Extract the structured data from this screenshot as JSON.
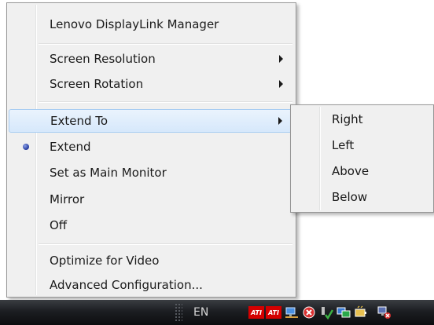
{
  "menu": {
    "items": [
      {
        "label": "Lenovo DisplayLink Manager"
      },
      {
        "label": "Screen Resolution",
        "submenu": true
      },
      {
        "label": "Screen Rotation",
        "submenu": true
      },
      {
        "label": "Extend To",
        "submenu": true,
        "highlighted": true
      },
      {
        "label": "Extend",
        "checked": true
      },
      {
        "label": "Set as Main Monitor"
      },
      {
        "label": "Mirror"
      },
      {
        "label": "Off"
      },
      {
        "label": "Optimize for Video"
      },
      {
        "label": "Advanced Configuration..."
      }
    ]
  },
  "submenu": {
    "items": [
      {
        "label": "Right"
      },
      {
        "label": "Left"
      },
      {
        "label": "Above"
      },
      {
        "label": "Below"
      }
    ]
  },
  "taskbar": {
    "language": "EN",
    "tray_icons": [
      "ati-icon",
      "ati-icon",
      "network-icon",
      "security-alert-icon",
      "safely-remove-hardware-icon",
      "displaylink-icon",
      "power-icon",
      "network-disconnected-icon"
    ],
    "ati_label": "ATI"
  },
  "colors": {
    "menu_bg": "#f0f0f0",
    "highlight_border": "#a8cdf2",
    "highlight_fill": "#d6e8fb",
    "taskbar": "#1c1e22"
  }
}
